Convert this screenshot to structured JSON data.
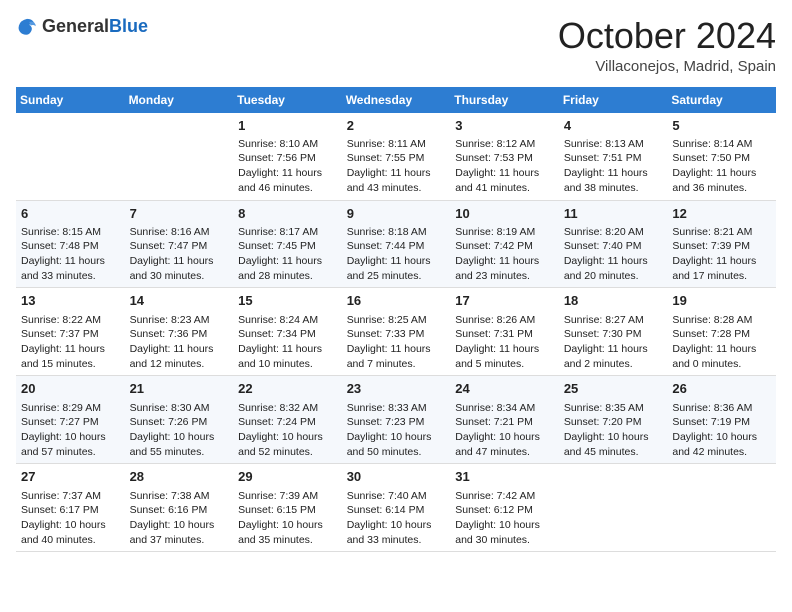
{
  "header": {
    "logo_general": "General",
    "logo_blue": "Blue",
    "month": "October 2024",
    "location": "Villaconejos, Madrid, Spain"
  },
  "weekdays": [
    "Sunday",
    "Monday",
    "Tuesday",
    "Wednesday",
    "Thursday",
    "Friday",
    "Saturday"
  ],
  "weeks": [
    [
      {
        "day": "",
        "content": ""
      },
      {
        "day": "",
        "content": ""
      },
      {
        "day": "1",
        "content": "Sunrise: 8:10 AM\nSunset: 7:56 PM\nDaylight: 11 hours and 46 minutes."
      },
      {
        "day": "2",
        "content": "Sunrise: 8:11 AM\nSunset: 7:55 PM\nDaylight: 11 hours and 43 minutes."
      },
      {
        "day": "3",
        "content": "Sunrise: 8:12 AM\nSunset: 7:53 PM\nDaylight: 11 hours and 41 minutes."
      },
      {
        "day": "4",
        "content": "Sunrise: 8:13 AM\nSunset: 7:51 PM\nDaylight: 11 hours and 38 minutes."
      },
      {
        "day": "5",
        "content": "Sunrise: 8:14 AM\nSunset: 7:50 PM\nDaylight: 11 hours and 36 minutes."
      }
    ],
    [
      {
        "day": "6",
        "content": "Sunrise: 8:15 AM\nSunset: 7:48 PM\nDaylight: 11 hours and 33 minutes."
      },
      {
        "day": "7",
        "content": "Sunrise: 8:16 AM\nSunset: 7:47 PM\nDaylight: 11 hours and 30 minutes."
      },
      {
        "day": "8",
        "content": "Sunrise: 8:17 AM\nSunset: 7:45 PM\nDaylight: 11 hours and 28 minutes."
      },
      {
        "day": "9",
        "content": "Sunrise: 8:18 AM\nSunset: 7:44 PM\nDaylight: 11 hours and 25 minutes."
      },
      {
        "day": "10",
        "content": "Sunrise: 8:19 AM\nSunset: 7:42 PM\nDaylight: 11 hours and 23 minutes."
      },
      {
        "day": "11",
        "content": "Sunrise: 8:20 AM\nSunset: 7:40 PM\nDaylight: 11 hours and 20 minutes."
      },
      {
        "day": "12",
        "content": "Sunrise: 8:21 AM\nSunset: 7:39 PM\nDaylight: 11 hours and 17 minutes."
      }
    ],
    [
      {
        "day": "13",
        "content": "Sunrise: 8:22 AM\nSunset: 7:37 PM\nDaylight: 11 hours and 15 minutes."
      },
      {
        "day": "14",
        "content": "Sunrise: 8:23 AM\nSunset: 7:36 PM\nDaylight: 11 hours and 12 minutes."
      },
      {
        "day": "15",
        "content": "Sunrise: 8:24 AM\nSunset: 7:34 PM\nDaylight: 11 hours and 10 minutes."
      },
      {
        "day": "16",
        "content": "Sunrise: 8:25 AM\nSunset: 7:33 PM\nDaylight: 11 hours and 7 minutes."
      },
      {
        "day": "17",
        "content": "Sunrise: 8:26 AM\nSunset: 7:31 PM\nDaylight: 11 hours and 5 minutes."
      },
      {
        "day": "18",
        "content": "Sunrise: 8:27 AM\nSunset: 7:30 PM\nDaylight: 11 hours and 2 minutes."
      },
      {
        "day": "19",
        "content": "Sunrise: 8:28 AM\nSunset: 7:28 PM\nDaylight: 11 hours and 0 minutes."
      }
    ],
    [
      {
        "day": "20",
        "content": "Sunrise: 8:29 AM\nSunset: 7:27 PM\nDaylight: 10 hours and 57 minutes."
      },
      {
        "day": "21",
        "content": "Sunrise: 8:30 AM\nSunset: 7:26 PM\nDaylight: 10 hours and 55 minutes."
      },
      {
        "day": "22",
        "content": "Sunrise: 8:32 AM\nSunset: 7:24 PM\nDaylight: 10 hours and 52 minutes."
      },
      {
        "day": "23",
        "content": "Sunrise: 8:33 AM\nSunset: 7:23 PM\nDaylight: 10 hours and 50 minutes."
      },
      {
        "day": "24",
        "content": "Sunrise: 8:34 AM\nSunset: 7:21 PM\nDaylight: 10 hours and 47 minutes."
      },
      {
        "day": "25",
        "content": "Sunrise: 8:35 AM\nSunset: 7:20 PM\nDaylight: 10 hours and 45 minutes."
      },
      {
        "day": "26",
        "content": "Sunrise: 8:36 AM\nSunset: 7:19 PM\nDaylight: 10 hours and 42 minutes."
      }
    ],
    [
      {
        "day": "27",
        "content": "Sunrise: 7:37 AM\nSunset: 6:17 PM\nDaylight: 10 hours and 40 minutes."
      },
      {
        "day": "28",
        "content": "Sunrise: 7:38 AM\nSunset: 6:16 PM\nDaylight: 10 hours and 37 minutes."
      },
      {
        "day": "29",
        "content": "Sunrise: 7:39 AM\nSunset: 6:15 PM\nDaylight: 10 hours and 35 minutes."
      },
      {
        "day": "30",
        "content": "Sunrise: 7:40 AM\nSunset: 6:14 PM\nDaylight: 10 hours and 33 minutes."
      },
      {
        "day": "31",
        "content": "Sunrise: 7:42 AM\nSunset: 6:12 PM\nDaylight: 10 hours and 30 minutes."
      },
      {
        "day": "",
        "content": ""
      },
      {
        "day": "",
        "content": ""
      }
    ]
  ]
}
